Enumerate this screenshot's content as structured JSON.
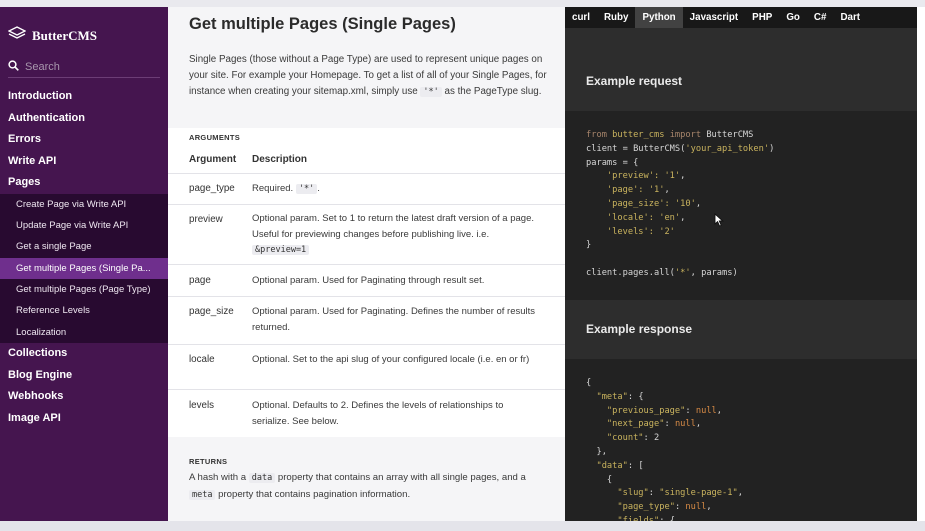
{
  "sidebar": {
    "brand": "ButterCMS",
    "search_placeholder": "Search",
    "items_before": [
      {
        "label": "Introduction"
      },
      {
        "label": "Authentication"
      },
      {
        "label": "Errors"
      },
      {
        "label": "Write API"
      },
      {
        "label": "Pages"
      }
    ],
    "subitems": [
      {
        "label": "Create Page via Write API"
      },
      {
        "label": "Update Page via Write API"
      },
      {
        "label": "Get a single Page"
      },
      {
        "label": "Get multiple Pages (Single Pa..."
      },
      {
        "label": "Get multiple Pages (Page Type)"
      },
      {
        "label": "Reference Levels"
      },
      {
        "label": "Localization"
      }
    ],
    "active_subitem": "Get multiple Pages (Single Pa...",
    "items_after": [
      {
        "label": "Collections"
      },
      {
        "label": "Blog Engine"
      },
      {
        "label": "Webhooks"
      },
      {
        "label": "Image API"
      }
    ]
  },
  "main": {
    "title": "Get multiple Pages (Single Pages)",
    "intro_before_code": "Single Pages (those without a Page Type) are used to represent unique pages on your site. For example your Homepage. To get a list of all of your Single Pages, for instance when creating your sitemap.xml, simply use ",
    "intro_code": "'*'",
    "intro_after_code": " as the PageType slug.",
    "arguments_heading": "ARGUMENTS",
    "column_argument": "Argument",
    "column_description": "Description",
    "rows": [
      {
        "arg": "page_type",
        "desc": "Required. ",
        "code": "'*'",
        "desc_after": "."
      },
      {
        "arg": "preview",
        "desc": "Optional param. Set to 1 to return the latest draft version of a page. Useful for previewing changes before publishing live. i.e. ",
        "code": "&preview=1",
        "desc_after": ""
      },
      {
        "arg": "page",
        "desc": "Optional param. Used for Paginating through result set.",
        "code": "",
        "desc_after": ""
      },
      {
        "arg": "page_size",
        "desc": "Optional param. Used for Paginating. Defines the number of results returned.",
        "code": "",
        "desc_after": ""
      },
      {
        "arg": "locale",
        "desc": "Optional. Set to the api slug of your configured locale (i.e. en or fr)",
        "code": "",
        "desc_after": ""
      },
      {
        "arg": "levels",
        "desc": "Optional. Defaults to 2. Defines the levels of relationships to serialize. See below.",
        "code": "",
        "desc_after": ""
      }
    ],
    "returns_heading": "RETURNS",
    "returns_1": "A hash with a ",
    "returns_code_1": "data",
    "returns_2": " property that contains an array with all single pages, and a ",
    "returns_code_2": "meta",
    "returns_3": " property that contains pagination information."
  },
  "code_panel": {
    "tabs": [
      "curl",
      "Ruby",
      "Python",
      "Javascript",
      "PHP",
      "Go",
      "C#",
      "Dart"
    ],
    "active_tab": "Python",
    "request_title": "Example request",
    "request_lines": [
      "from butter_cms import ButterCMS",
      "client = ButterCMS('your_api_token')",
      "params = {",
      "    'preview': '1',",
      "    'page': '1',",
      "    'page_size': '10',",
      "    'locale': 'en',",
      "    'levels': '2'",
      "}",
      "",
      "client.pages.all('*', params)"
    ],
    "response_title": "Example response",
    "response_lines": [
      "{",
      "  \"meta\": {",
      "    \"previous_page\": null,",
      "    \"next_page\": null,",
      "    \"count\": 2",
      "  },",
      "  \"data\": [",
      "    {",
      "      \"slug\": \"single-page-1\",",
      "      \"page_type\": null,",
      "      \"fields\": {"
    ]
  }
}
